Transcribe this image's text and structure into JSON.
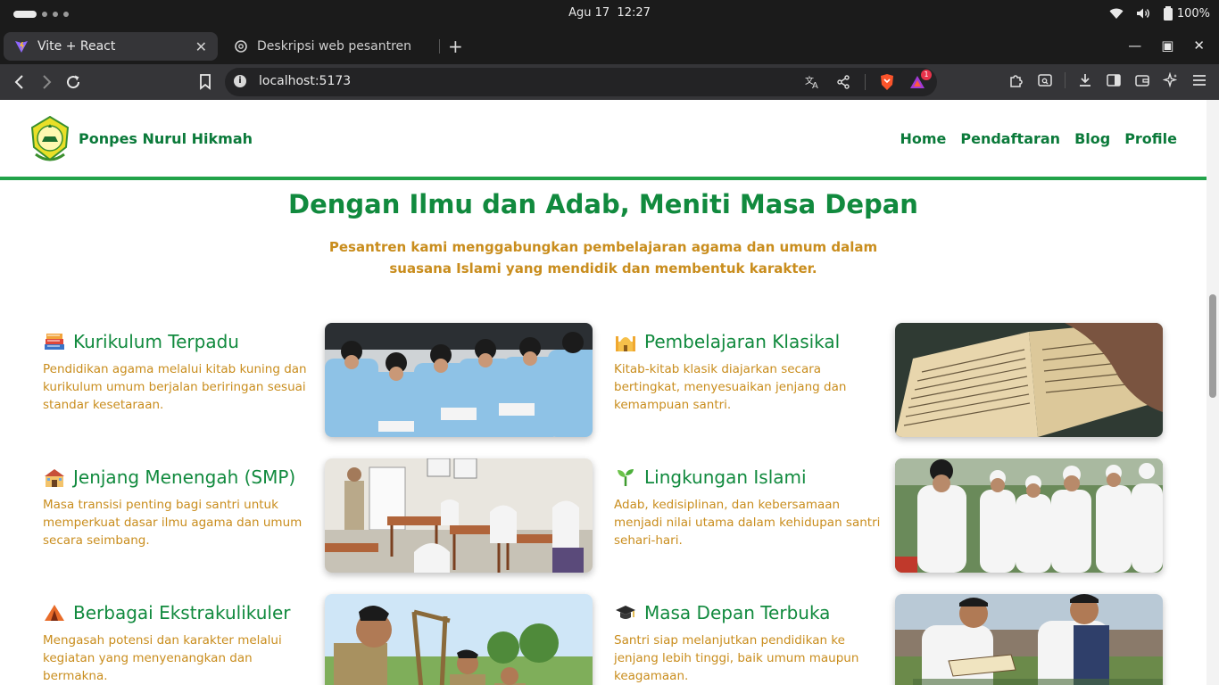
{
  "os": {
    "date": "Agu 17",
    "time": "12:27",
    "battery": "100%"
  },
  "tabs": [
    {
      "title": "Vite + React",
      "active": true
    },
    {
      "title": "Deskripsi web pesantren",
      "active": false
    }
  ],
  "omnibox": {
    "url": "localhost:5173"
  },
  "notif_badge": "1",
  "site": {
    "brand": "Ponpes Nurul Hikmah",
    "nav": [
      "Home",
      "Pendaftaran",
      "Blog",
      "Profile"
    ],
    "hero_title": "Dengan Ilmu dan Adab, Meniti Masa Depan",
    "hero_subtitle": "Pesantren kami menggabungkan pembelajaran agama dan umum dalam suasana Islami yang mendidik dan membentuk karakter.",
    "features": [
      {
        "emoji": "📚",
        "title": "Kurikulum Terpadu",
        "desc": "Pendidikan agama melalui kitab kuning dan kurikulum umum berjalan beriringan sesuai standar kesetaraan.",
        "image": "students-reading-photo"
      },
      {
        "emoji": "🕌",
        "title": "Pembelajaran Klasikal",
        "desc": "Kitab-kitab klasik diajarkan secara bertingkat, menyesuaikan jenjang dan kemampuan santri.",
        "image": "classical-book-photo"
      },
      {
        "emoji": "🏫",
        "title": "Jenjang Menengah (SMP)",
        "desc": "Masa transisi penting bagi santri untuk memperkuat dasar ilmu agama dan umum secara seimbang.",
        "image": "classroom-photo"
      },
      {
        "emoji": "🌱",
        "title": "Lingkungan Islami",
        "desc": "Adab, kedisiplinan, dan kebersamaan menjadi nilai utama dalam kehidupan santri sehari-hari.",
        "image": "praying-santri-photo"
      },
      {
        "emoji": "⛺",
        "title": "Berbagai Ekstrakulikuler",
        "desc": "Mengasah potensi dan karakter melalui kegiatan yang menyenangkan dan bermakna.",
        "image": "scout-activity-photo"
      },
      {
        "emoji": "🎓",
        "title": "Masa Depan Terbuka",
        "desc": "Santri siap melanjutkan pendidikan ke jenjang lebih tinggi, baik umum maupun keagamaan.",
        "image": "santri-outdoors-photo"
      }
    ]
  }
}
